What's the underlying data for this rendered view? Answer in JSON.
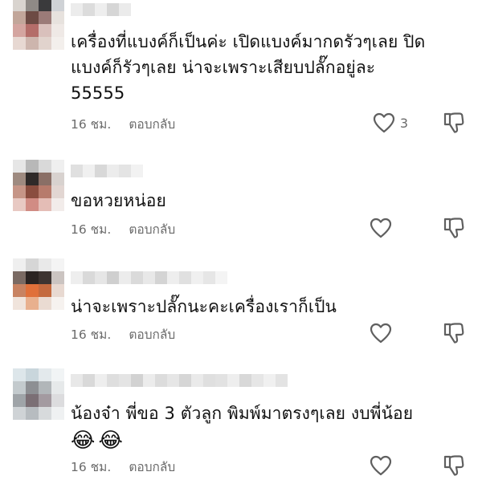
{
  "ui": {
    "reply_label": "ตอบกลับ",
    "like_icon": "heart-icon",
    "dislike_icon": "thumbs-down-icon"
  },
  "comments": [
    {
      "text_lines": [
        "เครื่องที่แบงค์ก็เป็นค่ะ เปิดแบงค์มากดรัวๆเลย ปิด",
        "แบงค์ก็รัวๆเลย น่าจะเพราะเสียบปลั๊กอยู่ละ",
        "55555"
      ],
      "time": "16 ชม.",
      "likes": "3",
      "avatar_colors": [
        "#d9d4cf",
        "#8f8a86",
        "#3a3a3c",
        "#cfd2d6",
        "#c2a69a",
        "#6d4b44",
        "#9b7b78",
        "#e7e2de",
        "#d4a5a0",
        "#b46d69",
        "#d9c0bc",
        "#efe9e6",
        "#e7d8d2",
        "#cdb5ad",
        "#e1d3cd",
        "#f3efec"
      ],
      "name_colors": [
        "#ececec",
        "#dcdcdc",
        "#eeeeee",
        "#d6d6d6",
        "#ebebeb"
      ]
    },
    {
      "text_lines": [
        "ขอหวยหน่อย"
      ],
      "time": "16 ชม.",
      "likes": "",
      "avatar_colors": [
        "#e6e6e6",
        "#b8b8b8",
        "#d9d9d9",
        "#efefef",
        "#9e8a80",
        "#2f2a29",
        "#8a6f66",
        "#d8d2cf",
        "#c69587",
        "#8a4d3f",
        "#b77b6c",
        "#e2d6d2",
        "#e8c9c3",
        "#d18c84",
        "#e4bdb6",
        "#f2ecea"
      ],
      "name_colors": [
        "#e0e0e0",
        "#f0f0f0",
        "#d8d8d8",
        "#ececec",
        "#e4e4e4",
        "#f2f2f2"
      ]
    },
    {
      "text_lines": [
        "น่าจะเพราะปลั๊กนะคะเครื่องเราก็เป็น"
      ],
      "time": "16 ชม.",
      "likes": "",
      "avatar_colors": [
        "#efefef",
        "#d6d6d6",
        "#e9e9e9",
        "#f4f4f4",
        "#7a6a63",
        "#2b2422",
        "#3d3431",
        "#cbc4c1",
        "#c88362",
        "#e0703a",
        "#c46a3f",
        "#e8d9d1",
        "#f0e4dc",
        "#e8b08e",
        "#eadbd2",
        "#f6f2ef"
      ],
      "name_colors": [
        "#eeeeee",
        "#d9d9d9",
        "#e6e6e6",
        "#cfcfcf",
        "#ececec",
        "#dadada",
        "#e8e8e8",
        "#d4d4d4",
        "#eeeeee",
        "#e0e0e0",
        "#f0f0f0",
        "#e6e6e6",
        "#f4f4f4"
      ]
    },
    {
      "text_lines": [
        "น้องจ๋า พี่ขอ 3 ตัวลูก พิมพ์มาตรงๆเลย งบพี่น้อย"
      ],
      "emojis": [
        "😂",
        "😂"
      ],
      "time": "16 ชม.",
      "likes": "",
      "avatar_colors": [
        "#dde6ea",
        "#c9d6dc",
        "#e3e9ec",
        "#f1f4f5",
        "#c3cacd",
        "#8d8f93",
        "#b1b6b9",
        "#e6e9ea",
        "#9fa4a8",
        "#7b6f75",
        "#a39aa0",
        "#dcdcde",
        "#cfd3d6",
        "#b7bcc0",
        "#d7dadc",
        "#eff1f2"
      ],
      "name_colors": [
        "#e8e8e8",
        "#d9d9d9",
        "#eeeeee",
        "#dedede",
        "#e4e4e4",
        "#d2d2d2",
        "#ececec",
        "#dcdcdc",
        "#e6e6e6",
        "#d6d6d6",
        "#eaeaea",
        "#dfdfdf",
        "#e2e2e2",
        "#eeeeee",
        "#d8d8d8",
        "#e6e6e6",
        "#f0f0f0",
        "#e3e3e3"
      ]
    }
  ]
}
